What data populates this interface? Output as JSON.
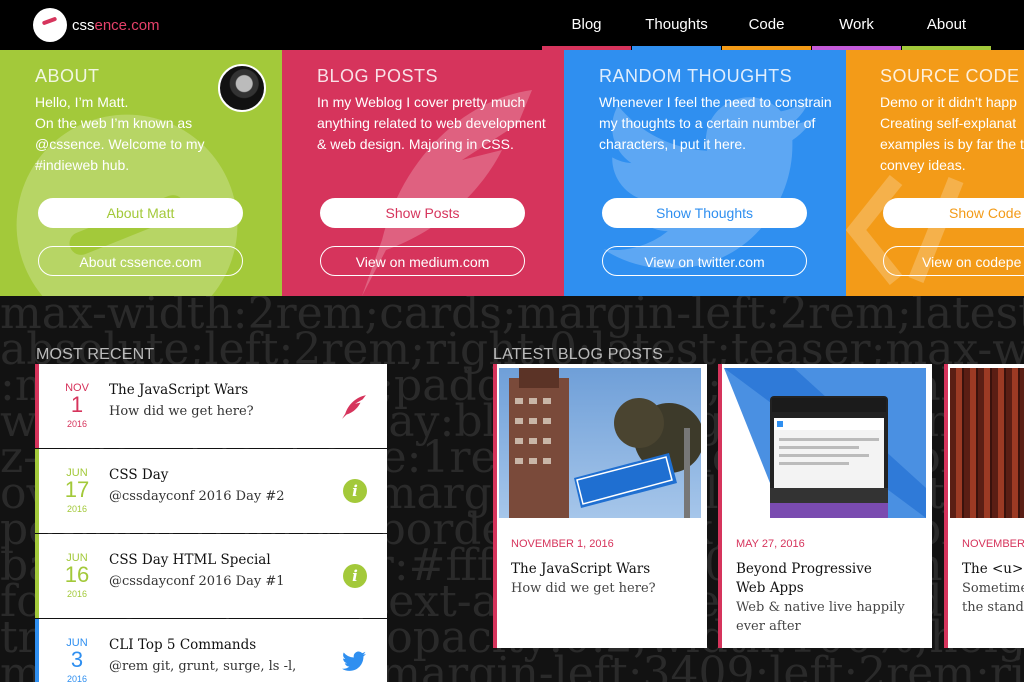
{
  "header": {
    "logo_text_a": "css",
    "logo_text_b": "ence.com",
    "nav": [
      {
        "label": "Blog",
        "color": "#d6345c"
      },
      {
        "label": "Thoughts",
        "color": "#2f8ff0"
      },
      {
        "label": "Code",
        "color": "#f39b18"
      },
      {
        "label": "Work",
        "color": "#c45bd9"
      },
      {
        "label": "About",
        "color": "#a3c93a"
      }
    ]
  },
  "cards": [
    {
      "title": "ABOUT",
      "text": "Hello, I’m Matt.\nOn the web I’m known as @cssence. Welcome to my #indieweb hub.",
      "solid_label": "About Matt",
      "outline_label": "About cssence.com",
      "color": "#a3c93a"
    },
    {
      "title": "BLOG POSTS",
      "text": "In my Weblog I cover pretty much anything related to web development & web design. Majoring in CSS.",
      "solid_label": "Show Posts",
      "outline_label": "View on medium.com",
      "color": "#d6345c"
    },
    {
      "title": "RANDOM THOUGHTS",
      "text": "Whenever I feel the need to constrain my thoughts to a certain number of characters, I put it here.",
      "solid_label": "Show Thoughts",
      "outline_label": "View on twitter.com",
      "color": "#2f8ff0"
    },
    {
      "title": "SOURCE CODE",
      "text": "Demo or it didn’t happ Creating self-explanat examples is by far the to convey ideas.",
      "solid_label": "Show Code",
      "outline_label": "View on codepe",
      "color": "#f39b18"
    }
  ],
  "most_recent": {
    "title": "MOST RECENT",
    "items": [
      {
        "month": "NOV",
        "day": "1",
        "year": "2016",
        "title": "The JavaScript Wars",
        "sub": "How did we get here?",
        "icon": "quill-icon",
        "color": "#d6345c"
      },
      {
        "month": "JUN",
        "day": "17",
        "year": "2016",
        "title": "CSS Day",
        "sub": "@cssdayconf 2016 Day #2",
        "icon": "info-icon",
        "color": "#a3c93a"
      },
      {
        "month": "JUN",
        "day": "16",
        "year": "2016",
        "title": "CSS Day HTML Special",
        "sub": "@cssdayconf 2016 Day #1",
        "icon": "info-icon",
        "color": "#a3c93a"
      },
      {
        "month": "JUN",
        "day": "3",
        "year": "2016",
        "title": "CLI Top 5 Commands",
        "sub": "@rem git, grunt, surge, ls -l,",
        "icon": "twitter-icon",
        "color": "#2f8ff0"
      }
    ]
  },
  "latest_posts": {
    "title": "LATEST BLOG POSTS",
    "items": [
      {
        "date": "NOVEMBER 1, 2016",
        "title": "The JavaScript Wars",
        "sub": "How did we get here?"
      },
      {
        "date": "MAY 27, 2016",
        "title": "Beyond Progressive Web Apps",
        "sub": "Web & native live happily ever after"
      },
      {
        "date": "NOVEMBER",
        "title": "The <u> in",
        "sub": "Sometime the standa"
      }
    ]
  },
  "info_glyph": "i"
}
